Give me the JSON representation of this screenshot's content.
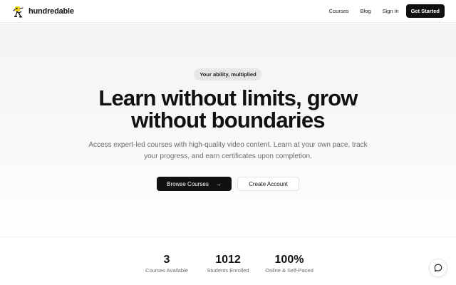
{
  "brand": {
    "name": "hundredable",
    "logo_icon": "runner-mascot-icon"
  },
  "nav": {
    "links": [
      "Courses",
      "Blog",
      "Sign in"
    ],
    "cta": "Get Started"
  },
  "hero": {
    "badge": "Your ability, multiplied",
    "headline_line1": "Learn without limits, grow",
    "headline_line2": "without boundaries",
    "subtext": "Access expert-led courses with high-quality video content. Learn at your own pace, track your progress, and earn certificates upon completion.",
    "primary_cta": "Browse Courses",
    "primary_cta_icon": "arrow-right-icon",
    "secondary_cta": "Create Account"
  },
  "stats": [
    {
      "value": "3",
      "label": "Courses Available"
    },
    {
      "value": "1012",
      "label": "Students Enrolled"
    },
    {
      "value": "100%",
      "label": "Online & Self-Paced"
    }
  ],
  "chat_widget": {
    "icon": "chat-bubble-icon"
  },
  "colors": {
    "primary": "#111111",
    "muted_text": "#6b6b70",
    "badge_bg": "#e6e6e8"
  }
}
